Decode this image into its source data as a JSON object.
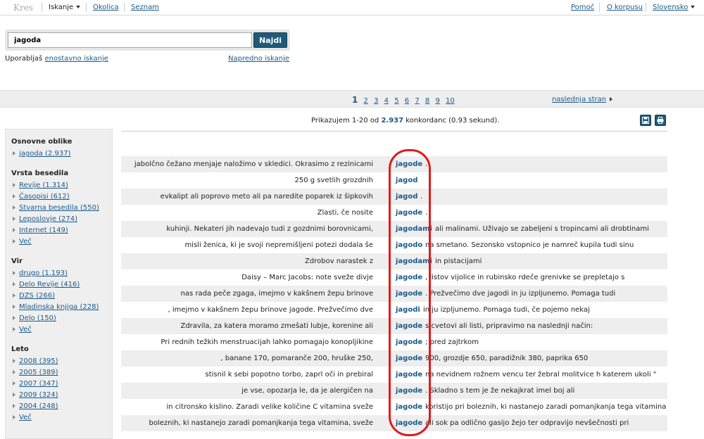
{
  "app": {
    "logo": "Kres",
    "nav": [
      {
        "label": "Iskanje",
        "dropdown": true
      },
      {
        "label": "Okolica",
        "dropdown": false
      },
      {
        "label": "Seznam",
        "dropdown": false
      }
    ],
    "right_nav": [
      {
        "label": "Pomoč",
        "dropdown": false
      },
      {
        "label": "O korpusu",
        "dropdown": false
      },
      {
        "label": "Slovensko",
        "dropdown": true
      }
    ]
  },
  "search": {
    "value": "jagoda",
    "button_label": "Najdi",
    "mode_prefix": "Uporabljaš",
    "mode_link": "enostavno iskanje",
    "advanced_link": "Napredno iskanje"
  },
  "pagination": {
    "current": "1",
    "pages": [
      "2",
      "3",
      "4",
      "5",
      "6",
      "7",
      "8",
      "9",
      "10"
    ],
    "next_label": "naslednja stran"
  },
  "summary": {
    "prefix": "Prikazujem 1-20 od",
    "total": "2.937",
    "suffix": "konkordanc (0.93 sekund)."
  },
  "sidebar": {
    "sections": [
      {
        "title": "Osnovne oblike",
        "items": [
          "jagoda (2.937)"
        ]
      },
      {
        "title": "Vrsta besedila",
        "items": [
          "Revije (1.314)",
          "Časopisi (612)",
          "Stvarna besedila (550)",
          "Leposlovje (274)",
          "Internet (149)",
          "Več"
        ]
      },
      {
        "title": "Vir",
        "items": [
          "drugo (1.193)",
          "Delo Revije (416)",
          "DZS (266)",
          "Mladinska knjiga (228)",
          "Delo (150)",
          "Več"
        ]
      },
      {
        "title": "Leto",
        "items": [
          "2008 (395)",
          "2005 (389)",
          "2007 (347)",
          "2009 (324)",
          "2004 (248)",
          "Več"
        ]
      }
    ]
  },
  "concordance": [
    {
      "left": "jabolčno čežano menjaje naložimo v skledici. Okrasimo z rezinicami",
      "kw": "jagode",
      "right": "."
    },
    {
      "left": "250 g svetlih grozdnih",
      "kw": "jagod",
      "right": ""
    },
    {
      "left": "evkalipt ali poprovo meto ali pa naredite poparek iz šipkovih",
      "kw": "jagod",
      "right": "."
    },
    {
      "left": "Zlasti, če nosite",
      "kw": "jagode",
      "right": "."
    },
    {
      "left": "kuhinji. Nekateri jih nadevajo tudi z gozdnimi borovnicami,",
      "kw": "jagodami",
      "right": "ali malinami. Uživajo se zabeljeni s tropincami ali drobtinami"
    },
    {
      "left": "misli ženica, ki je svoji nepremišljeni potezi dodala še",
      "kw": "jagodo",
      "right": "na smetano. Sezonsko vstopnico je namreč kupila tudi sinu"
    },
    {
      "left": "Zdrobov narastek z",
      "kw": "jagodami",
      "right": "in pistacijami"
    },
    {
      "left": "Daisy – Marc Jacobs: note sveže divje",
      "kw": "jagode",
      "right": ", listov vijolice in rubinsko rdeče grenivke se prepletajo s"
    },
    {
      "left": "nas rada peče zgaga, imejmo v kakšnem žepu brinove",
      "kw": "jagode",
      "right": ". Prežvečimo dve jagodi in ju izpljunemo. Pomaga tudi"
    },
    {
      "left": ", imejmo v kakšnem žepu brinove jagode. Prežvečimo dve",
      "kw": "jagodi",
      "right": "in ju izpljunemo. Pomaga tudi, če pojemo nekaj"
    },
    {
      "left": "Zdravila, za katera moramo zmešati lubje, korenine ali",
      "kw": "jagode",
      "right": "s cvetovi ali listi, pripravimo na naslednji način:"
    },
    {
      "left": "Pri rednih težkih menstruacijah lahko pomagajo konopljikine",
      "kw": "jagode",
      "right": "; pred zajtrkom"
    },
    {
      "left": ", banane 170, pomaranče 200, hruške 250,",
      "kw": "jagode",
      "right": "900, grozdje 650, paradižnik 380, paprika 650"
    },
    {
      "left": "stisnil k sebi popotno torbo, zaprl oči in prebiral",
      "kw": "jagode",
      "right": "na nevidnem rožnem vencu ter žebral molitvice h katerem ukoli \""
    },
    {
      "left": "je vse, opozarja le, da je alergičen na",
      "kw": "jagode",
      "right": ". Skladno s tem je že nekajkrat imel boj ali"
    },
    {
      "left": "in citronsko kislino. Zaradi velike količine C vitamina sveže",
      "kw": "jagode",
      "right": "koristijo pri boleznih, ki nastanejo zaradi pomanjkanja tega vitamina"
    },
    {
      "left": "boleznih, ki nastanejo zaradi pomanjkanja tega vitamina, sveže",
      "kw": "jagode",
      "right": "ali sok pa odlično gasijo žejo ter odpravijo nevšečnosti pri"
    }
  ]
}
